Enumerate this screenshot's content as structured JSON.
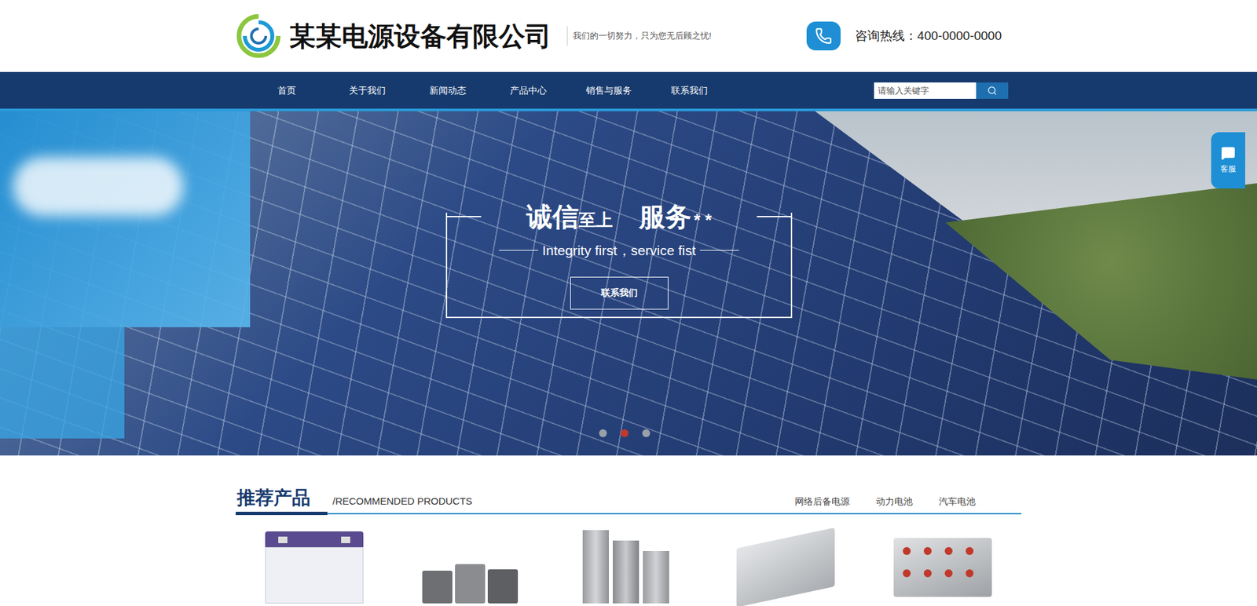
{
  "header": {
    "company": "某某电源设备有限公司",
    "slogan": "我们的一切努力，只为您无后顾之忧!",
    "hotline_label": "咨询热线：",
    "hotline": "400-0000-0000"
  },
  "nav": {
    "items": [
      {
        "label": "首页",
        "selected": false
      },
      {
        "label": "关于我们",
        "selected": false
      },
      {
        "label": "新闻动态",
        "selected": false
      },
      {
        "label": "产品中心",
        "selected": false
      },
      {
        "label": "销售与服务",
        "selected": false
      },
      {
        "label": "联系我们",
        "selected": false
      }
    ],
    "search": {
      "placeholder": "请输入关键字"
    }
  },
  "banner": {
    "title_a": "诚信",
    "title_a_small": "至上",
    "title_b": "服务",
    "title_b_suffix": "* *",
    "subtitle": "Integrity first，service fist",
    "button": "联系我们",
    "dots": [
      {
        "selected": false
      },
      {
        "selected": true
      },
      {
        "selected": false
      }
    ]
  },
  "float_service": {
    "label": "客服"
  },
  "section": {
    "title": "推荐产品",
    "subtitle": "/RECOMMENDED PRODUCTS",
    "tabs": [
      {
        "label": "网络后备电源",
        "selected": false
      },
      {
        "label": "动力电池",
        "selected": false
      },
      {
        "label": "汽车电池",
        "selected": false
      }
    ]
  },
  "products": [
    {
      "kind": "white-battery"
    },
    {
      "kind": "battery-set"
    },
    {
      "kind": "tall-battery"
    },
    {
      "kind": "module"
    },
    {
      "kind": "cabinet"
    }
  ]
}
